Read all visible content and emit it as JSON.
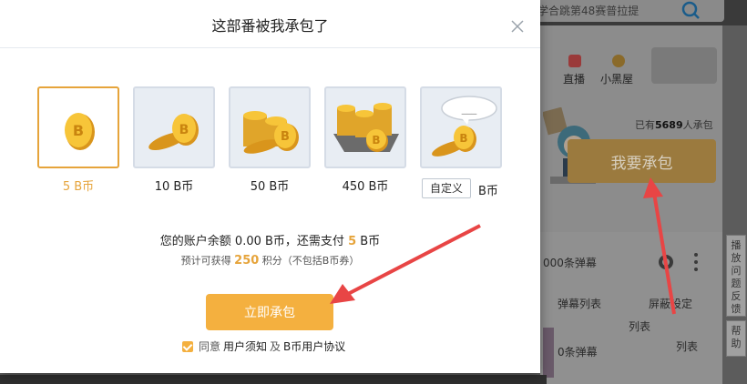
{
  "background": {
    "search_text": "学合跳第48赛普拉提",
    "nav": [
      "直播",
      "小黑屋"
    ],
    "supporters": {
      "prefix": "已有",
      "count": "5689",
      "suffix": "人承包"
    },
    "big_button": "我要承包",
    "danmaku": {
      "count": "000条弹幕",
      "list_tab": "弹幕列表",
      "settings_tab": "屏蔽设定",
      "extra1": "列表",
      "extra2": "列表",
      "count2": "0条弹幕"
    },
    "side_buttons": [
      "播放问题反馈",
      "帮助"
    ]
  },
  "modal": {
    "title": "这部番被我承包了",
    "options": [
      {
        "label": "5 B币",
        "selected": true
      },
      {
        "label": "10 B币",
        "selected": false
      },
      {
        "label": "50 B币",
        "selected": false
      },
      {
        "label": "450 B币",
        "selected": false
      }
    ],
    "custom": {
      "placeholder_label": "自定义",
      "unit": "B币",
      "bubble": "___"
    },
    "balance": {
      "prefix": "您的账户余额 0.00 B币，还需支付",
      "amount": "5",
      "suffix": "B币"
    },
    "points": {
      "prefix": "预计可获得",
      "value": "250",
      "suffix": "积分（不包括B币券）"
    },
    "confirm_button": "立即承包",
    "agreement": {
      "prefix": "同意",
      "link1": "用户须知",
      "middle": "及",
      "link2": "B币用户协议",
      "checked": true
    }
  },
  "colors": {
    "accent": "#f4b03f",
    "selected": "#e6a43b",
    "arrow": "#e84545"
  }
}
